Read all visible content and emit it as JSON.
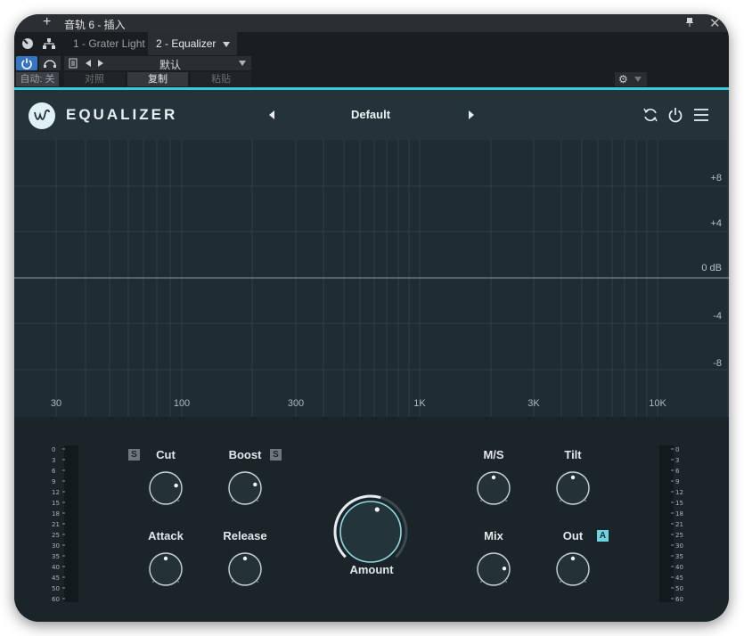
{
  "host": {
    "title": "音轨 6 - 插入",
    "tabs": [
      {
        "label": "1 - Grater Light"
      },
      {
        "label": "2 - Equalizer"
      }
    ],
    "preset_name": "默认",
    "auto_label": "自动: 关",
    "compare_label": "对照",
    "copy_label": "复制",
    "paste_label": "粘贴"
  },
  "plugin": {
    "name": "EQUALIZER",
    "preset": "Default",
    "accent_color": "#39c9d9"
  },
  "graph": {
    "db_labels": [
      "+8",
      "+4",
      "0 dB",
      "-4",
      "-8"
    ],
    "freq_labels": [
      "30",
      "100",
      "300",
      "1K",
      "3K",
      "10K"
    ]
  },
  "knobs": {
    "cut": {
      "label": "Cut",
      "value": 0.78
    },
    "boost": {
      "label": "Boost",
      "value": 0.76
    },
    "attack": {
      "label": "Attack",
      "value": 0.5
    },
    "release": {
      "label": "Release",
      "value": 0.5
    },
    "amount": {
      "label": "Amount",
      "value": 0.56
    },
    "ms": {
      "label": "M/S",
      "value": 0.5
    },
    "tilt": {
      "label": "Tilt",
      "value": 0.5
    },
    "mix": {
      "label": "Mix",
      "value": 0.82
    },
    "out": {
      "label": "Out",
      "value": 0.5
    }
  },
  "badges": {
    "s": "S",
    "a": "A"
  },
  "meters": {
    "scale": [
      "0",
      "3",
      "6",
      "9",
      "12",
      "15",
      "18",
      "21",
      "25",
      "30",
      "35",
      "40",
      "45",
      "50",
      "60"
    ]
  }
}
